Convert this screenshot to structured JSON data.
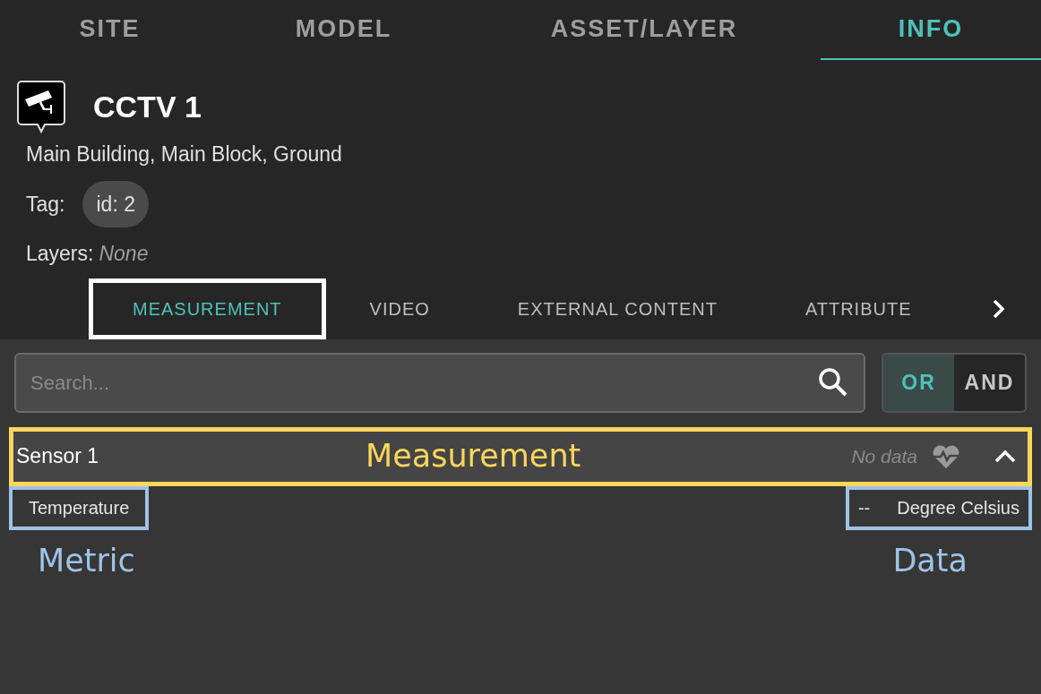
{
  "main_tabs": [
    {
      "label": "SITE",
      "selected": false
    },
    {
      "label": "MODEL",
      "selected": false
    },
    {
      "label": "ASSET/LAYER",
      "selected": false
    },
    {
      "label": "INFO",
      "selected": true
    }
  ],
  "asset": {
    "title": "CCTV 1",
    "location": "Main Building, Main Block, Ground",
    "tag_label": "Tag:",
    "tag": "id: 2",
    "layers_label": "Layers:",
    "layers_value": "None"
  },
  "sub_tabs": [
    {
      "label": "MEASUREMENT",
      "selected": true,
      "color": "#ffffff"
    },
    {
      "label": "VIDEO",
      "selected": false
    },
    {
      "label": "EXTERNAL CONTENT",
      "selected": false
    },
    {
      "label": "ATTRIBUTE",
      "selected": false
    }
  ],
  "search": {
    "placeholder": "Search..."
  },
  "logic_toggle": [
    {
      "label": "OR",
      "selected": true
    },
    {
      "label": "AND",
      "selected": false
    }
  ],
  "measurement": {
    "name": "Sensor 1",
    "status": "No data",
    "expanded": true,
    "color": "#f9d65c",
    "annotation": "Measurement",
    "metrics": [
      {
        "name": "Temperature",
        "value": "--",
        "unit": "Degree Celsius"
      }
    ]
  },
  "metric_annotations": [
    {
      "label": "Metric",
      "color": "#9ec3e6"
    },
    {
      "label": "Data",
      "color": "#9ec3e6"
    }
  ]
}
